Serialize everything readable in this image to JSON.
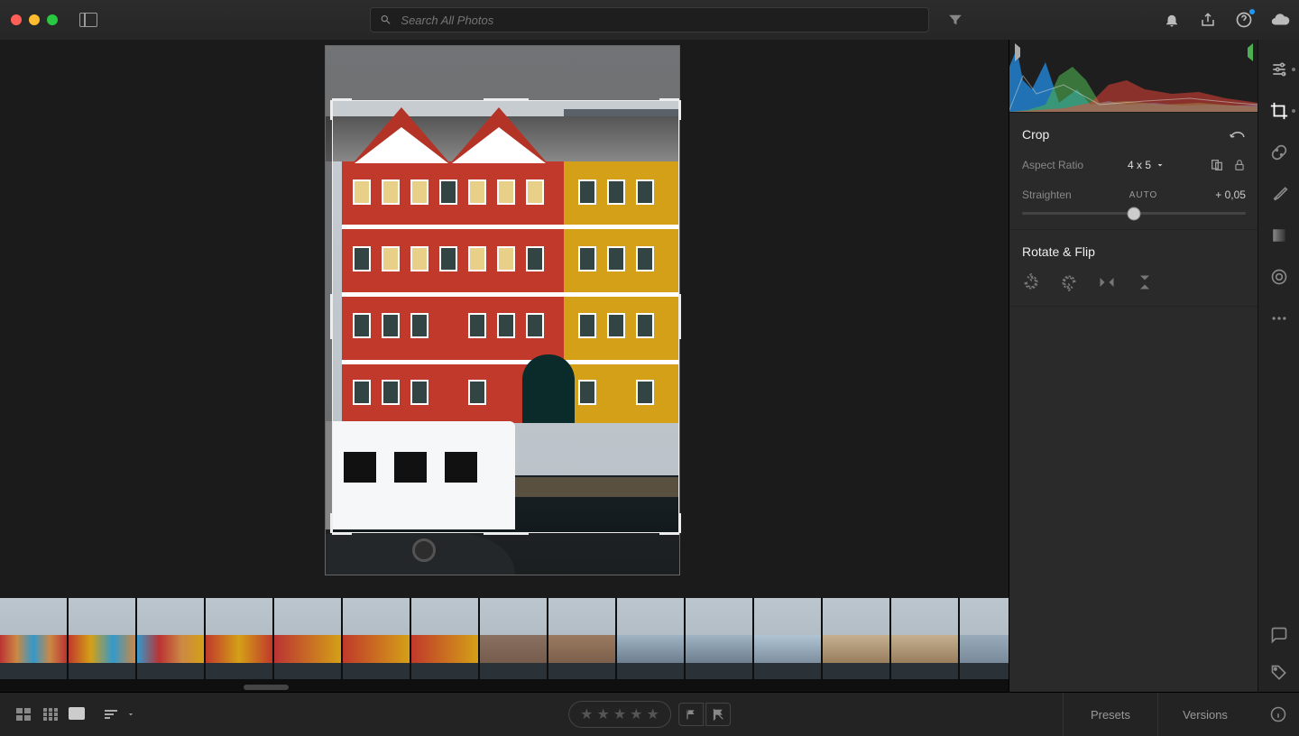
{
  "header": {
    "search_placeholder": "Search All Photos"
  },
  "panel": {
    "crop_title": "Crop",
    "aspect_label": "Aspect Ratio",
    "aspect_value": "4 x 5",
    "straighten_label": "Straighten",
    "auto_label": "AUTO",
    "straighten_value": "+ 0,05",
    "rotate_title": "Rotate & Flip"
  },
  "bottom": {
    "presets_label": "Presets",
    "versions_label": "Versions"
  },
  "filmstrip": {
    "selected_index": 6,
    "count": 15
  },
  "colors": {
    "accent": "#2196f3",
    "red_building": "#c0392b",
    "yellow_building": "#d4a017"
  }
}
